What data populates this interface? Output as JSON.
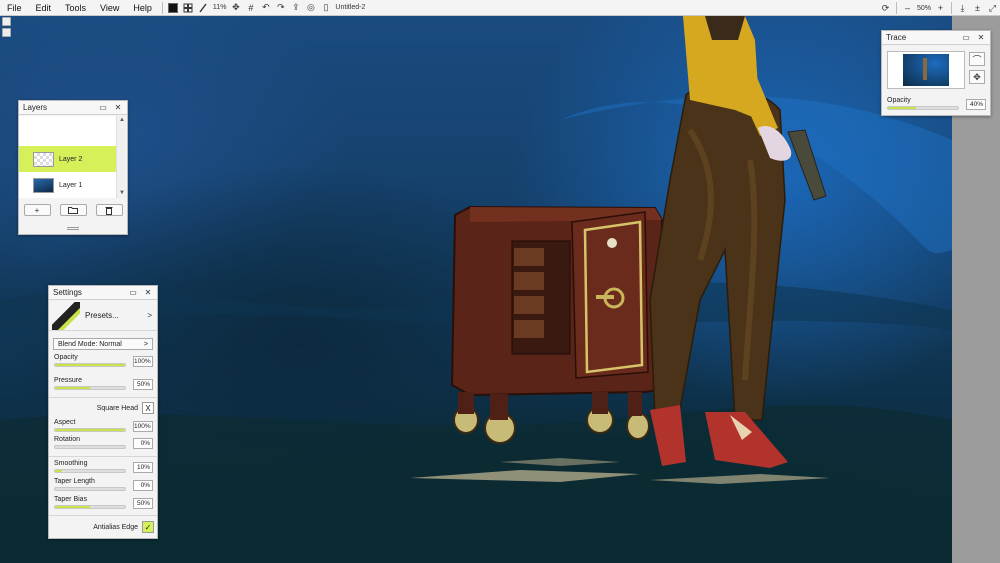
{
  "menu": {
    "items": [
      "File",
      "Edit",
      "Tools",
      "View",
      "Help"
    ],
    "zoom_level": "11%",
    "document_title": "Untitled-2"
  },
  "view_controls": {
    "zoom_level": "50%",
    "zoom_out": "–",
    "zoom_in": "+"
  },
  "layers_panel": {
    "title": "Layers",
    "layers": [
      {
        "name": "Layer 2",
        "active": true
      },
      {
        "name": "Layer 1",
        "active": false
      }
    ],
    "add_label": "+",
    "folder_icon": "folder-icon",
    "delete_icon": "trash-icon"
  },
  "settings_panel": {
    "title": "Settings",
    "presets_label": "Presets...",
    "presets_chevron": ">",
    "blend_mode": "Blend Mode: Normal",
    "blend_chevron": ">",
    "sliders": [
      {
        "label": "Opacity",
        "value": "100%",
        "fraction": 1.0
      },
      {
        "label": "Pressure",
        "value": "50%",
        "fraction": 0.5
      },
      {
        "label": "Aspect",
        "value": "100%",
        "fraction": 1.0
      },
      {
        "label": "Rotation",
        "value": "0%",
        "fraction": 0.0
      },
      {
        "label": "Smoothing",
        "value": "10%",
        "fraction": 0.1
      },
      {
        "label": "Taper Length",
        "value": "0%",
        "fraction": 0.0
      },
      {
        "label": "Taper Bias",
        "value": "50%",
        "fraction": 0.5
      }
    ],
    "square_head_label": "Square Head",
    "square_head_mark": "X",
    "antialias_label": "Antialias Edge",
    "antialias_mark": "✓"
  },
  "trace_panel": {
    "title": "Trace",
    "opacity_label": "Opacity",
    "opacity_value": "40%",
    "opacity_fraction": 0.4
  },
  "colors": {
    "accent": "#d6f05a",
    "slider_fill": "#c7e44a"
  }
}
